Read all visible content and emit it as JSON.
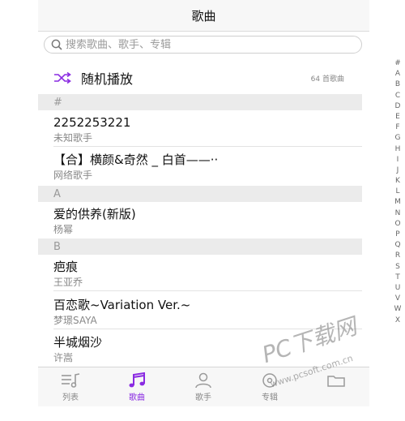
{
  "header": {
    "title": "歌曲"
  },
  "search": {
    "placeholder": "搜索歌曲、歌手、专辑"
  },
  "shuffle": {
    "label": "随机播放",
    "count": "64 首歌曲"
  },
  "sections": [
    {
      "label": "#",
      "songs": [
        {
          "title": "2252253221",
          "artist": "未知歌手"
        },
        {
          "title": "【合】横颜&奇然 _ 白首——·· ",
          "artist": "网络歌手"
        }
      ]
    },
    {
      "label": "A",
      "songs": [
        {
          "title": "爱的供养(新版)",
          "artist": "杨幂"
        }
      ]
    },
    {
      "label": "B",
      "songs": [
        {
          "title": "疤痕",
          "artist": "王亚乔"
        },
        {
          "title": "百恋歌~Variation Ver.~",
          "artist": "梦璟SAYA"
        },
        {
          "title": "半城烟沙",
          "artist": "许嵩"
        }
      ]
    }
  ],
  "index_letters": [
    "#",
    "A",
    "B",
    "C",
    "D",
    "E",
    "F",
    "G",
    "H",
    "I",
    "J",
    "K",
    "L",
    "M",
    "N",
    "O",
    "P",
    "Q",
    "R",
    "S",
    "T",
    "U",
    "V",
    "W",
    "X"
  ],
  "tabs": [
    {
      "label": "列表",
      "icon": "list-icon",
      "active": false
    },
    {
      "label": "歌曲",
      "icon": "music-note-icon",
      "active": true
    },
    {
      "label": "歌手",
      "icon": "person-icon",
      "active": false
    },
    {
      "label": "专辑",
      "icon": "album-icon",
      "active": false
    },
    {
      "label": "",
      "icon": "folder-icon",
      "active": false
    }
  ],
  "watermark": {
    "brand": "PC下载网",
    "url": "www.pcsoft.com.cn"
  },
  "colors": {
    "accent": "#8a2be2",
    "section_bg": "#ebebeb"
  }
}
